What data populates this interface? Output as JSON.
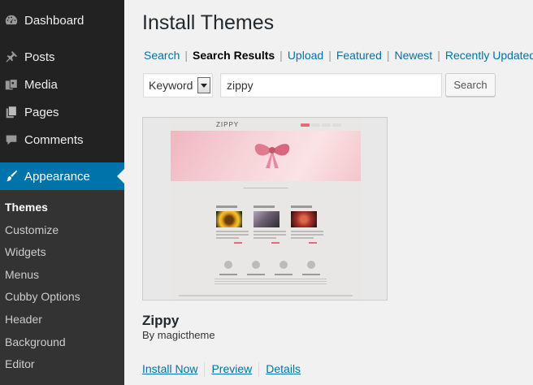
{
  "sidebar": {
    "items": [
      {
        "label": "Dashboard",
        "icon": "dashboard-icon"
      },
      {
        "label": "Posts",
        "icon": "pin-icon"
      },
      {
        "label": "Media",
        "icon": "media-icon"
      },
      {
        "label": "Pages",
        "icon": "pages-icon"
      },
      {
        "label": "Comments",
        "icon": "comment-icon"
      },
      {
        "label": "Appearance",
        "icon": "brush-icon"
      }
    ],
    "submenu": [
      "Themes",
      "Customize",
      "Widgets",
      "Menus",
      "Cubby Options",
      "Header",
      "Background",
      "Editor"
    ],
    "active_color": "#0073aa"
  },
  "page": {
    "title": "Install Themes",
    "subnav": {
      "search": "Search",
      "search_results": "Search Results",
      "upload": "Upload",
      "featured": "Featured",
      "newest": "Newest",
      "recently_updated": "Recently Updated",
      "separator": "|"
    },
    "search": {
      "type_value": "Keyword",
      "query": "zippy",
      "button": "Search"
    }
  },
  "theme": {
    "name": "Zippy",
    "author": "By magictheme",
    "screenshot_logo": "ZIPPY",
    "actions": {
      "install": "Install Now",
      "preview": "Preview",
      "details": "Details"
    }
  }
}
